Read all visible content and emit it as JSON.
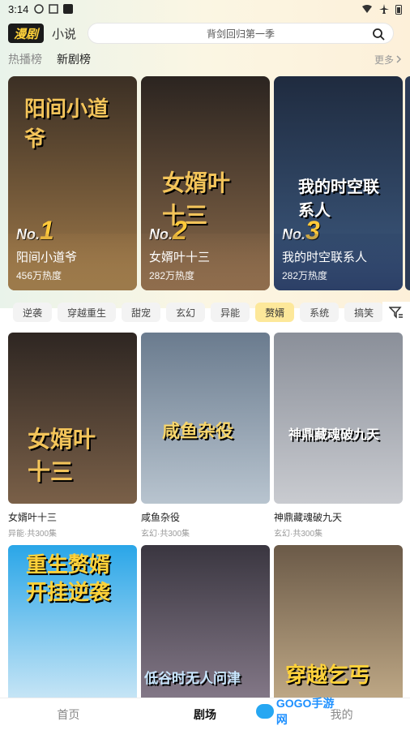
{
  "status": {
    "time": "3:14"
  },
  "header": {
    "logo": "漫剧",
    "novel_tab": "小说",
    "search_placeholder": "背剑回归第一季"
  },
  "rank_tabs": {
    "hot": "热播榜",
    "new": "新剧榜",
    "more": "更多"
  },
  "rankings": [
    {
      "rank_label": "No.",
      "rank": "1",
      "title": "阳间小道爷",
      "heat": "456万热度",
      "art_text": "阳间小道爷",
      "colors": [
        "#3b2f24",
        "#a07a4a"
      ]
    },
    {
      "rank_label": "No.",
      "rank": "2",
      "title": "女婿叶十三",
      "heat": "282万热度",
      "art_text": "女婿叶十三",
      "colors": [
        "#2b2420",
        "#8a6a4a"
      ]
    },
    {
      "rank_label": "No.",
      "rank": "3",
      "title": "我的时空联系人",
      "heat": "282万热度",
      "art_text": "我的时空联系人",
      "colors": [
        "#1f2b3f",
        "#3d5a80"
      ]
    }
  ],
  "genres": [
    "逆袭",
    "穿越重生",
    "甜宠",
    "玄幻",
    "异能",
    "赘婿",
    "系统",
    "搞笑"
  ],
  "active_genre": "赘婿",
  "shows": [
    {
      "title": "女婿叶十三",
      "sub": "异能·共300集",
      "cover_text": "女婿叶十三",
      "colors": [
        "#2e2622",
        "#7a6048"
      ]
    },
    {
      "title": "咸鱼杂役",
      "sub": "玄幻·共300集",
      "cover_text": "咸鱼杂役",
      "colors": [
        "#6a7b8e",
        "#b8c4cf"
      ]
    },
    {
      "title": "神鼎藏魂破九天",
      "sub": "玄幻·共300集",
      "cover_text": "神鼎藏魂破九天",
      "colors": [
        "#8a8f99",
        "#c9cbd0"
      ]
    },
    {
      "title": "",
      "sub": "",
      "cover_text": "重生赘婿开挂逆袭",
      "colors": [
        "#2aa6e8",
        "#d8ecf7"
      ]
    },
    {
      "title": "",
      "sub": "",
      "cover_text": "低谷时无人问津",
      "colors": [
        "#3a3640",
        "#8b7f8f"
      ]
    },
    {
      "title": "",
      "sub": "",
      "cover_text": "穿越乞丐",
      "colors": [
        "#6b5a48",
        "#c7b08c"
      ]
    }
  ],
  "nav": {
    "home": "首页",
    "drama": "剧场",
    "mine": "我的"
  },
  "watermark": "GOGO手游网"
}
